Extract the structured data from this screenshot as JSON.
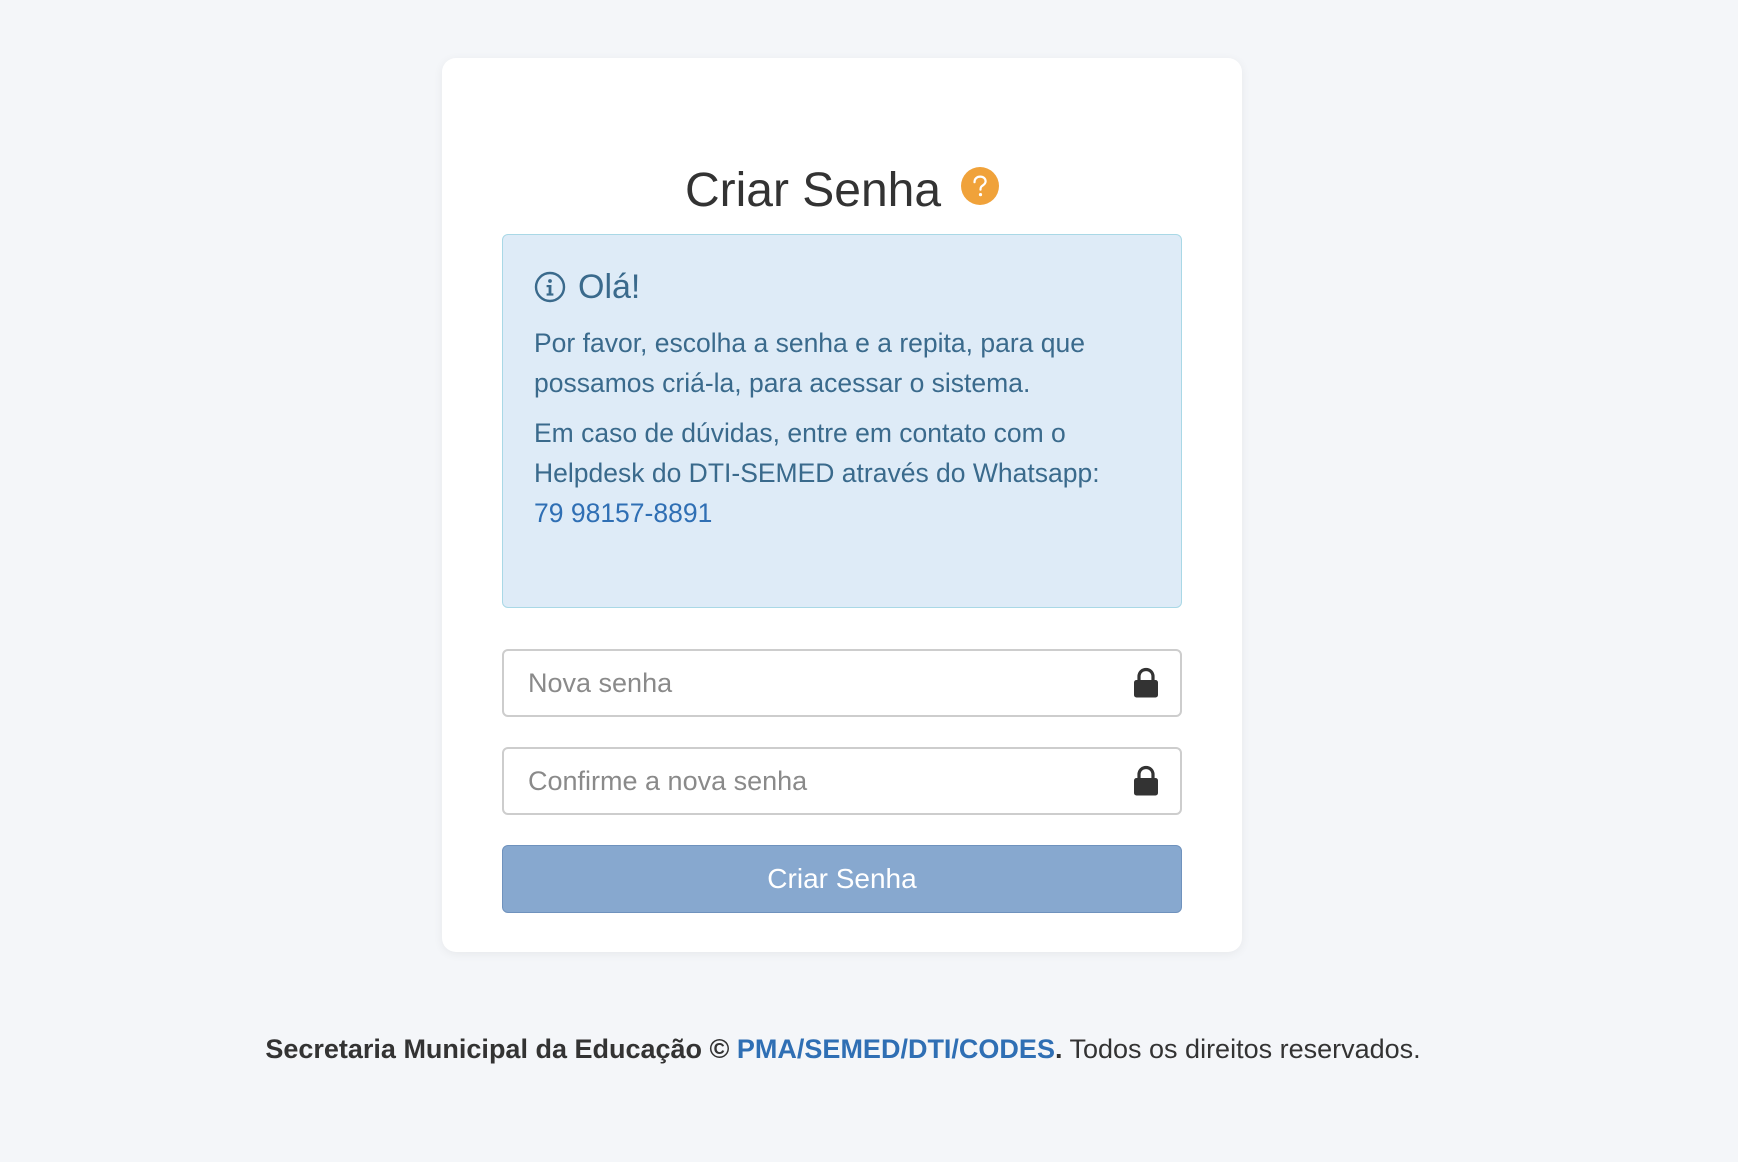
{
  "card": {
    "title": "Criar Senha"
  },
  "alert": {
    "heading": "Olá!",
    "paragraph1": "Por favor, escolha a senha e a repita, para que possamos criá-la, para acessar o sistema.",
    "paragraph2_prefix": "Em caso de dúvidas, entre em contato com o Helpdesk do DTI-SEMED através do Whatsapp: ",
    "phone": "79 98157-8891"
  },
  "form": {
    "new_password_placeholder": "Nova senha",
    "confirm_password_placeholder": "Confirme a nova senha",
    "submit_label": "Criar Senha"
  },
  "footer": {
    "org": "Secretaria Municipal da Educação ©",
    "link": "PMA/SEMED/DTI/CODES",
    "dot": ".",
    "rights": " Todos os direitos reservados."
  },
  "icons": {
    "help": "question-circle-icon",
    "info": "info-circle-icon",
    "lock": "lock-icon"
  },
  "colors": {
    "background": "#f4f6f9",
    "help_icon": "#f0a23a",
    "alert_bg": "#deebf7",
    "alert_text": "#3a6a8c",
    "link": "#2f6fb4",
    "button_bg": "#87a8cf"
  }
}
